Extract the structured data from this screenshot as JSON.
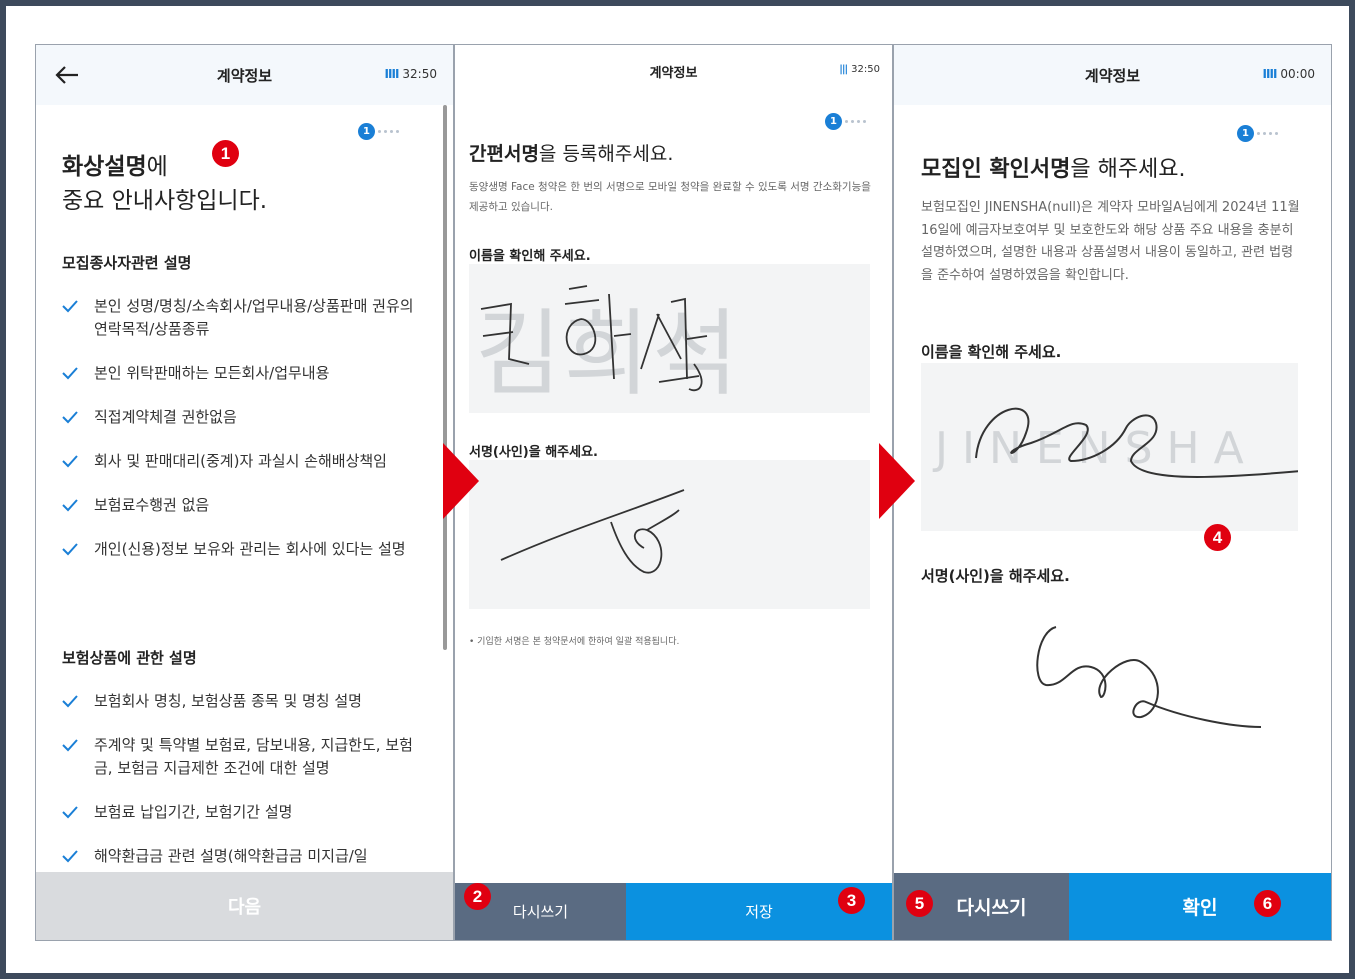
{
  "panel1": {
    "title": "계약정보",
    "timer": "32:50",
    "timer_bars": "IIII",
    "step": "1",
    "heading_bold": "화상설명",
    "heading_rest": "에",
    "heading_line2": "중요 안내사항입니다.",
    "section1_title": "모집종사자관련 설명",
    "section1_items": [
      "본인 성명/명칭/소속회사/업무내용/상품판매 권유의 연락목적/상품종류",
      "본인 위탁판매하는 모든회사/업무내용",
      "직접계약체결 권한없음",
      "회사 및 판매대리(중계)자 과실시 손해배상책임",
      "보험료수행권 없음",
      "개인(신용)정보 보유와 관리는 회사에 있다는 설명"
    ],
    "section2_title": "보험상품에 관한 설명",
    "section2_items": [
      "보험회사 명칭, 보험상품 종목 및 명칭 설명",
      "주계약 및 특약별 보험료, 담보내용, 지급한도, 보험금, 보험금 지급제한 조건에 대한 설명",
      "보험료 납입기간, 보험기간 설명",
      "해약환급금 관련 설명(해약환급금 미지급/일"
    ],
    "next_label": "다음"
  },
  "panel2": {
    "title": "계약정보",
    "timer": "32:50",
    "timer_bars": "|||",
    "step": "1",
    "heading_bold": "간편서명",
    "heading_rest": "을 등록해주세요.",
    "desc": "동양생명 Face 청약은 한 번의 서명으로 모바일 청약을 완료할 수 있도록 서명 간소화기능을 제공하고 있습니다.",
    "name_label": "이름을 확인해 주세요.",
    "ghost_name": "김희석",
    "sign_label": "서명(사인)을 해주세요.",
    "note": "•  기입한 서명은 본 청약문서에 한하여 일괄 적용됩니다.",
    "rewrite_label": "다시쓰기",
    "save_label": "저장"
  },
  "panel3": {
    "title": "계약정보",
    "timer": "00:00",
    "timer_bars": "IIII",
    "step": "1",
    "heading_bold": "모집인 확인서명",
    "heading_rest": "을 해주세요.",
    "desc": "보험모집인 JINENSHA(null)은 계약자 모바일A님에게 2024년 11월 16일에 예금자보호여부 및 보호한도와 해당 상품 주요 내용을 충분히 설명하였으며, 설명한 내용과 상품설명서 내용이 동일하고, 관련 법령을 준수하여 설명하였음을 확인합니다.",
    "name_label": "이름을 확인해 주세요.",
    "ghost_name": "JINENSHA",
    "sign_label": "서명(사인)을 해주세요.",
    "rewrite_label": "다시쓰기",
    "confirm_label": "확인"
  },
  "badges": [
    "1",
    "2",
    "3",
    "4",
    "5",
    "6"
  ],
  "colors": {
    "accent_blue": "#0b91e0",
    "badge_red": "#e00010",
    "rewrite_gray": "#5a6b82",
    "disabled_gray": "#d9dbde"
  }
}
